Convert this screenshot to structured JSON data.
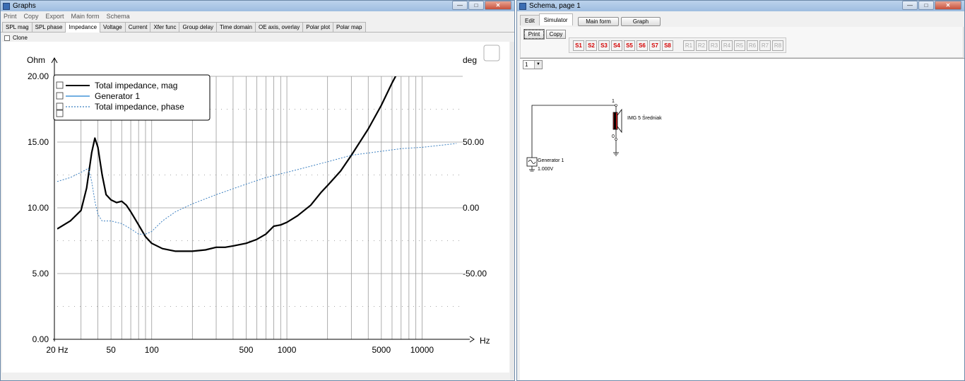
{
  "graphs_window": {
    "title": "Graphs",
    "menu": [
      "Print",
      "Copy",
      "Export",
      "Main form",
      "Schema"
    ],
    "tabs": [
      "SPL mag",
      "SPL phase",
      "Impedance",
      "Voltage",
      "Current",
      "Xfer func",
      "Group delay",
      "Time domain",
      "OE axis, overlay",
      "Polar plot",
      "Polar map"
    ],
    "active_tab": "Impedance",
    "clone_label": "Clone"
  },
  "chart_data": {
    "type": "line",
    "x_scale": "log",
    "xlim": [
      20,
      20000
    ],
    "ylim_left": [
      0,
      20
    ],
    "ylim_right": [
      -100,
      100
    ],
    "left_unit_label": "Ohm",
    "right_unit_label": "deg",
    "x_unit_label": "Hz",
    "left_ticks": [
      "20.00",
      "15.00",
      "10.00",
      "5.00",
      "0.00"
    ],
    "left_tick_values": [
      20,
      15,
      10,
      5,
      0
    ],
    "right_ticks": [
      "50.00",
      "0.00",
      "-50.00"
    ],
    "right_tick_values": [
      50,
      0,
      -50
    ],
    "x_ticks": [
      "20 Hz",
      "50",
      "100",
      "500",
      "1000",
      "5000",
      "10000"
    ],
    "x_tick_values": [
      20,
      50,
      100,
      500,
      1000,
      5000,
      10000
    ],
    "grid": true,
    "legend_position": "top-left",
    "series": [
      {
        "name": "Total impedance, mag",
        "axis": "left",
        "color": "#000000",
        "style": "solid-thick",
        "points": [
          [
            20,
            8.4
          ],
          [
            25,
            9.0
          ],
          [
            30,
            9.8
          ],
          [
            33,
            11.5
          ],
          [
            36,
            14.2
          ],
          [
            38,
            15.3
          ],
          [
            40,
            14.6
          ],
          [
            43,
            12.5
          ],
          [
            46,
            11.0
          ],
          [
            50,
            10.6
          ],
          [
            55,
            10.4
          ],
          [
            60,
            10.5
          ],
          [
            65,
            10.2
          ],
          [
            70,
            9.7
          ],
          [
            80,
            8.7
          ],
          [
            90,
            7.8
          ],
          [
            100,
            7.3
          ],
          [
            120,
            6.9
          ],
          [
            150,
            6.7
          ],
          [
            200,
            6.7
          ],
          [
            250,
            6.8
          ],
          [
            300,
            7.0
          ],
          [
            350,
            7.0
          ],
          [
            400,
            7.1
          ],
          [
            500,
            7.3
          ],
          [
            600,
            7.6
          ],
          [
            700,
            8.0
          ],
          [
            800,
            8.6
          ],
          [
            900,
            8.7
          ],
          [
            1000,
            8.9
          ],
          [
            1200,
            9.4
          ],
          [
            1500,
            10.2
          ],
          [
            1800,
            11.2
          ],
          [
            2000,
            11.7
          ],
          [
            2500,
            12.8
          ],
          [
            3000,
            14.0
          ],
          [
            4000,
            16.0
          ],
          [
            5000,
            17.8
          ],
          [
            6000,
            19.5
          ],
          [
            6600,
            20.3
          ]
        ]
      },
      {
        "name": "Generator 1",
        "axis": "left",
        "color": "#1e7fd0",
        "style": "solid",
        "points": []
      },
      {
        "name": "Total impedance, phase",
        "axis": "right",
        "color": "#3a7fc0",
        "style": "dotted",
        "points": [
          [
            20,
            20
          ],
          [
            25,
            23
          ],
          [
            30,
            27
          ],
          [
            34,
            30
          ],
          [
            36,
            20
          ],
          [
            38,
            5
          ],
          [
            40,
            -5
          ],
          [
            43,
            -10
          ],
          [
            50,
            -10
          ],
          [
            60,
            -12
          ],
          [
            70,
            -16
          ],
          [
            80,
            -20
          ],
          [
            90,
            -20
          ],
          [
            100,
            -18
          ],
          [
            120,
            -10
          ],
          [
            150,
            -3
          ],
          [
            200,
            3
          ],
          [
            300,
            10
          ],
          [
            500,
            18
          ],
          [
            700,
            23
          ],
          [
            1000,
            27
          ],
          [
            2000,
            35
          ],
          [
            3000,
            40
          ],
          [
            5000,
            43
          ],
          [
            7000,
            45
          ],
          [
            10000,
            46
          ],
          [
            15000,
            48
          ],
          [
            18000,
            49
          ]
        ]
      }
    ]
  },
  "schema_window": {
    "title": "Schema, page 1",
    "tabs": [
      "Edit",
      "Simulator"
    ],
    "active_tab": "Simulator",
    "main_form_label": "Main form",
    "graph_label": "Graph",
    "print_label": "Print",
    "copy_label": "Copy",
    "s_buttons": [
      "S1",
      "S2",
      "S3",
      "S4",
      "S5",
      "S6",
      "S7",
      "S8"
    ],
    "r_buttons": [
      "R1",
      "R2",
      "R3",
      "R4",
      "R5",
      "R6",
      "R7",
      "R8"
    ],
    "page_value": "1",
    "generator_label": "Generator 1",
    "generator_voltage": "1.000V",
    "speaker_label": "IMG 5 Średniak",
    "pin_top": "1",
    "pin_bottom": "0"
  }
}
